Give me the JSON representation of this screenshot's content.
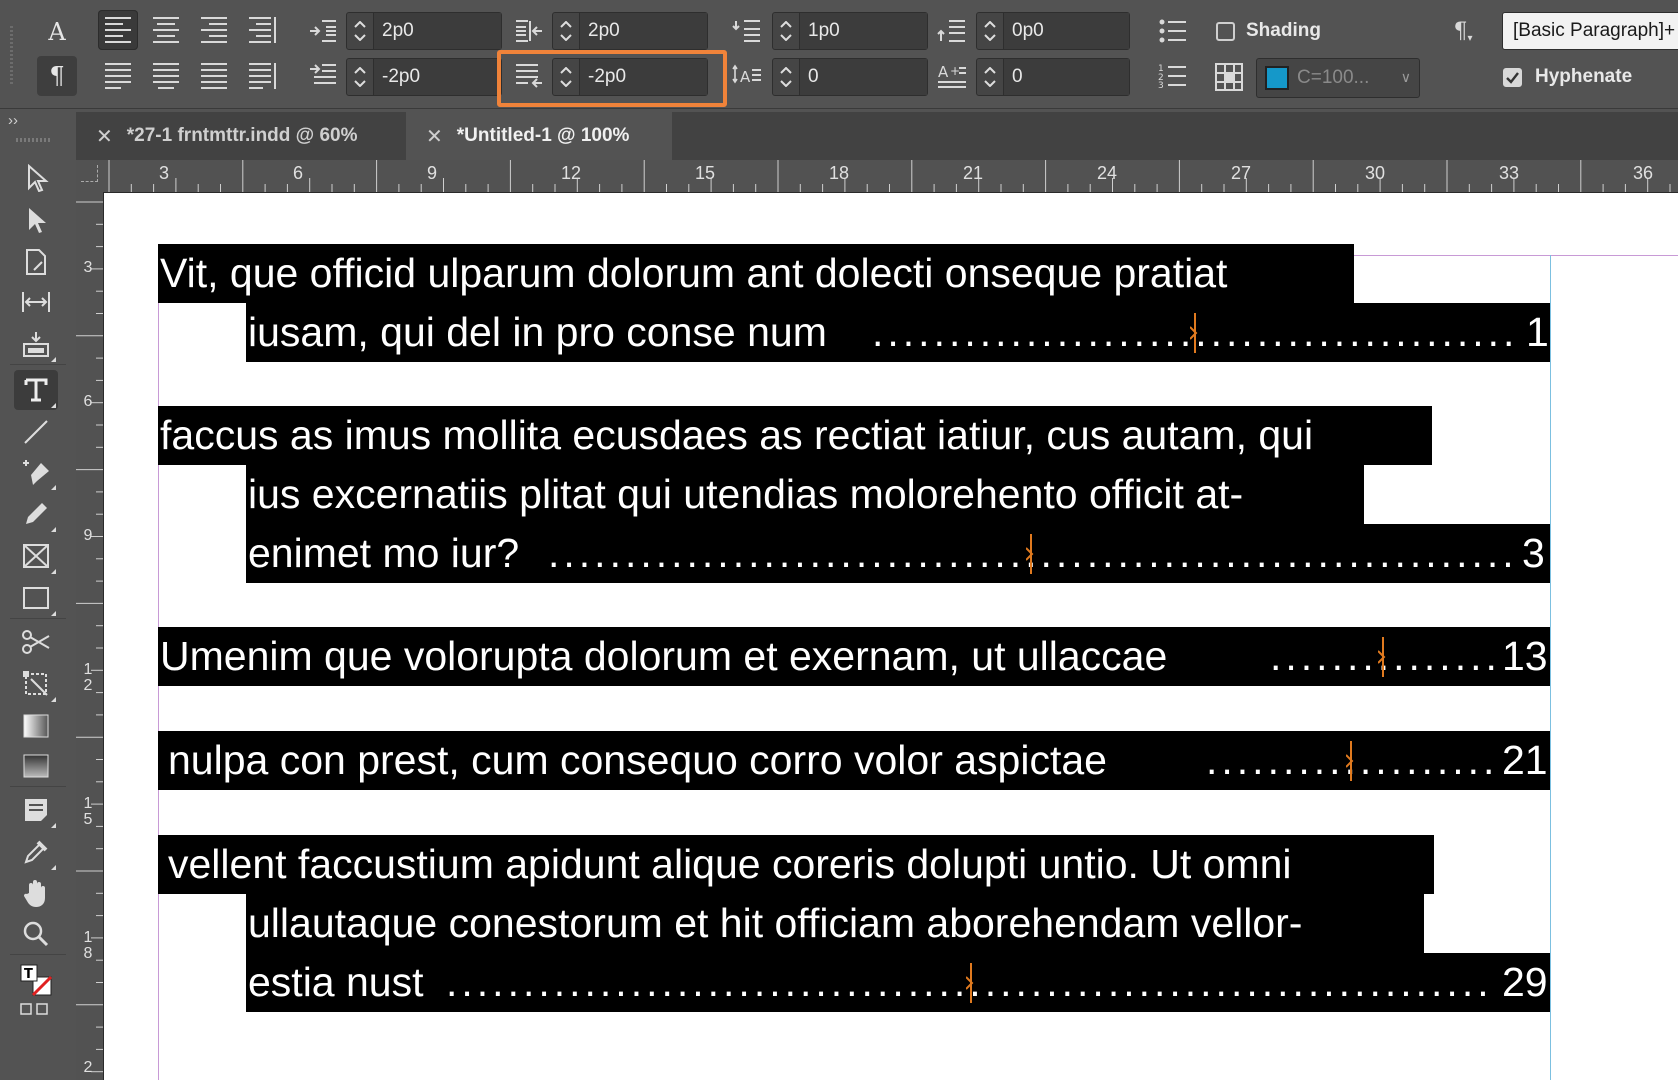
{
  "control_panel": {
    "char_mode_label": "A",
    "para_mode_label": "¶",
    "left_indent": "2p0",
    "right_indent": "2p0",
    "first_line_indent": "-2p0",
    "last_line_right_indent": "-2p0",
    "space_before": "1p0",
    "space_after": "0p0",
    "drop_cap_lines": "0",
    "drop_cap_chars": "0",
    "shading_label": "Shading",
    "shading_checked": false,
    "swatch_value": "C=100...",
    "swatch_color": "#1598c9",
    "hyphenate_label": "Hyphenate",
    "hyphenate_checked": true,
    "paragraph_style": "[Basic Paragraph]+"
  },
  "tabs": [
    {
      "label": "*27-1 frntmttr.indd @ 60%",
      "active": false
    },
    {
      "label": "*Untitled-1 @ 100%",
      "active": true
    }
  ],
  "rulers": {
    "horizontal": [
      "3",
      "6",
      "9",
      "12",
      "15",
      "18",
      "21",
      "24",
      "27",
      "30",
      "33",
      "36"
    ],
    "vertical": [
      "3",
      "6",
      "9",
      "1\n2",
      "1\n5",
      "1\n8",
      "2"
    ]
  },
  "toc_entries": [
    {
      "lines": [
        "Vit, que officid ulparum dolorum ant dolecti onseque pratiat",
        "iusam, qui del in pro conse num"
      ],
      "page": "1"
    },
    {
      "lines": [
        "faccus as imus mollita ecusdaes as rectiat iatiur, cus autam, qui",
        "ius excernatiis plitat qui utendias molorehento officit at-",
        "enimet mo iur?"
      ],
      "page": "3"
    },
    {
      "lines": [
        "Umenim que volorupta dolorum et exernam, ut ullaccae"
      ],
      "page": "13"
    },
    {
      "lines": [
        "nulpa con prest, cum consequo corro volor aspictae"
      ],
      "page": "21"
    },
    {
      "lines": [
        "vellent faccustium apidunt alique coreris dolupti untio. Ut omni",
        "ullautaque conestorum et hit officiam aborehendam vellor-",
        "estia nust"
      ],
      "page": "29"
    }
  ],
  "colors": {
    "ui_background": "#535353",
    "highlight": "#f0833a",
    "hidden_char_marks": "#e07a1f",
    "text_selection": "#000000",
    "guide": "#c89ad6"
  }
}
